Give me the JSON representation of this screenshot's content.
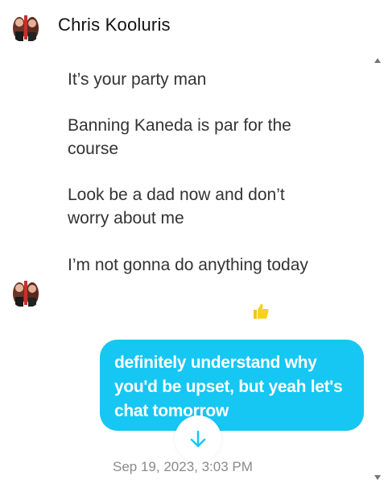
{
  "header": {
    "contact_name": "Chris Kooluris",
    "avatar_icon": "contact-avatar"
  },
  "messages": [
    {
      "text": "It’s your party man"
    },
    {
      "text": "Banning Kaneda is par for the course"
    },
    {
      "text": "Look be a dad now and don’t worry about me"
    },
    {
      "text": "I’m not gonna do anything today"
    }
  ],
  "reaction": {
    "icon": "thumbs-up-icon",
    "glyph": "👍",
    "color": "#f7d21c"
  },
  "sent_message": {
    "text": "definitely understand why you'd be upset, but yeah let's chat tomorrow",
    "bubble_color": "#16c6f3"
  },
  "jump_button": {
    "icon": "arrow-down-icon",
    "color": "#16c6f3"
  },
  "timestamp": "Sep 19, 2023, 3:03 PM"
}
